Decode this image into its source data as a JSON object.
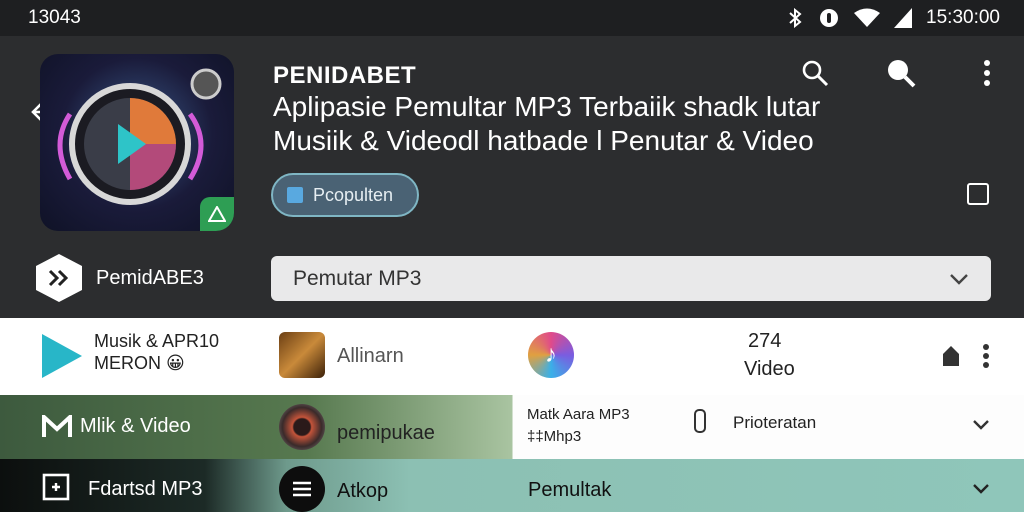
{
  "status": {
    "left_text": "13043",
    "time": "15:30:00"
  },
  "header": {
    "app_name": "PENIDABET",
    "description": "Aplipasie Pemultar MP3 Terbaiik  shadk lutar Musiik & Videodl  hatbade l Penutar & Video",
    "chip_label": "Pcopulten"
  },
  "filter": {
    "brand_label": "PemidABE3",
    "dropdown_value": "Pemutar MP3"
  },
  "rows": [
    {
      "title": "Musik & APR10 MERON 😀",
      "thumb_label": "Allinarn",
      "count": "274",
      "count_label": "Video"
    },
    {
      "title": "Mlik & Video",
      "thumb_label": "pemipukae",
      "sub_line1": "Matk Aara MP3",
      "sub_line2": "‡‡Mhp3",
      "status": "Prioteratan"
    },
    {
      "title": "Fdartsd MP3",
      "thumb_label": "Atkop",
      "status": "Pemultak"
    }
  ],
  "colors": {
    "accent_teal": "#28b6c8",
    "chip_border": "#7fb6c4",
    "dropdown_bg": "#e9e9ea"
  }
}
